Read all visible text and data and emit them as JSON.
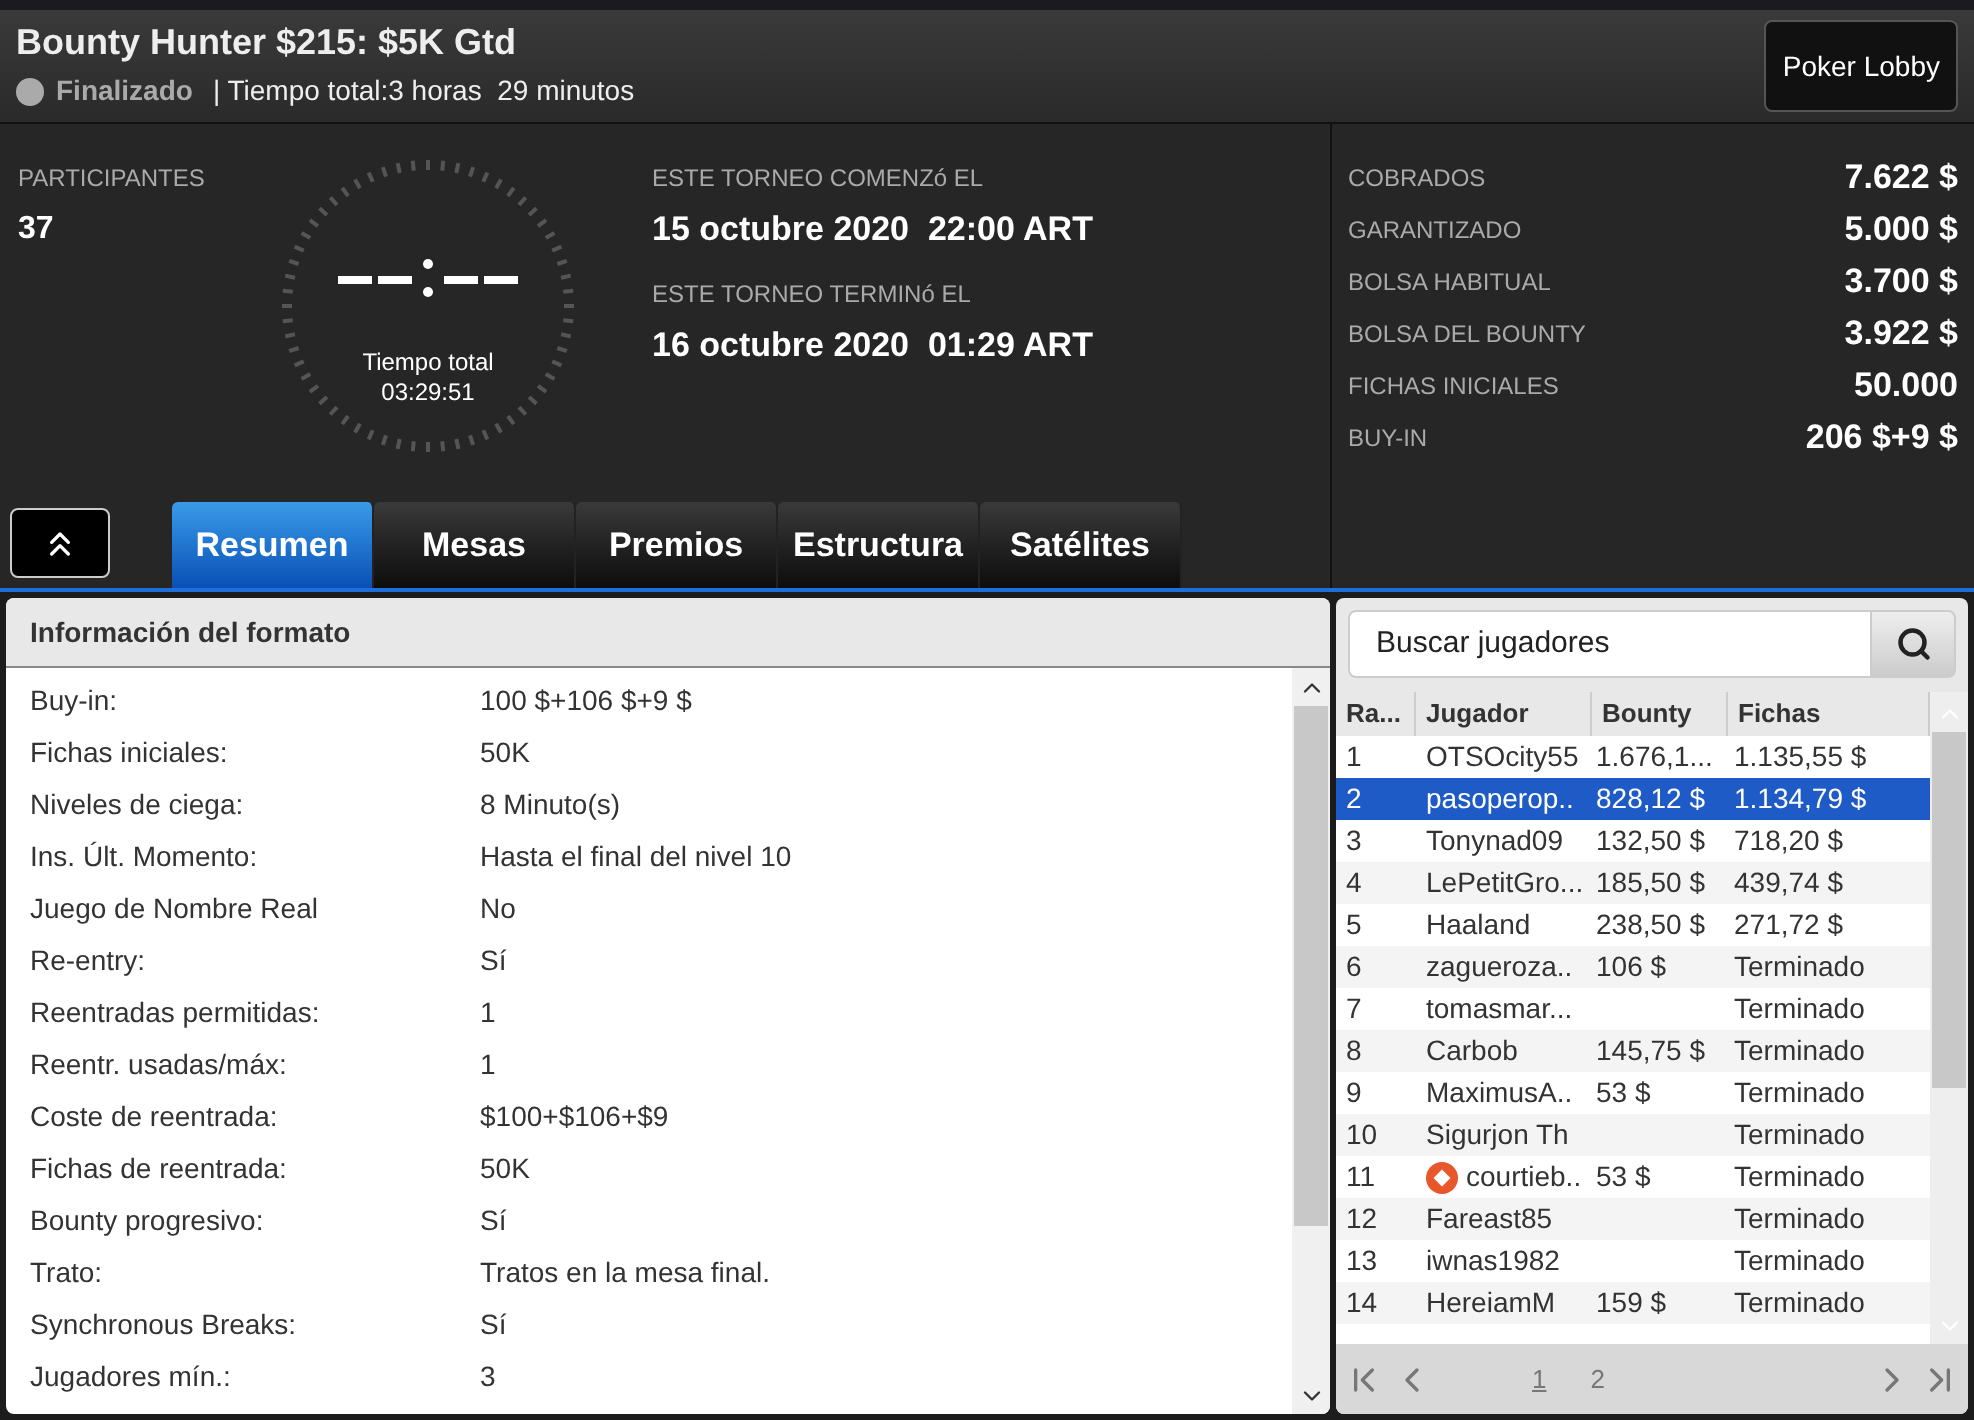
{
  "header": {
    "title": "Bounty Hunter $215: $5K Gtd",
    "status": "Finalizado",
    "duration": "| Tiempo total:3 horas  29 minutos",
    "lobby_button": "Poker Lobby"
  },
  "summary": {
    "participants_label": "PARTICIPANTES",
    "participants": "37",
    "clock_caption": "Tiempo total",
    "clock_time": "03:29:51",
    "dates": [
      {
        "label": "ESTE TORNEO COMENZó EL",
        "value": "15 octubre 2020  22:00 ART"
      },
      {
        "label": "ESTE TORNEO TERMINó EL",
        "value": "16 octubre 2020  01:29 ART"
      }
    ]
  },
  "stats": [
    {
      "label": "COBRADOS",
      "value": "7.622 $"
    },
    {
      "label": "GARANTIZADO",
      "value": "5.000 $"
    },
    {
      "label": "BOLSA HABITUAL",
      "value": "3.700 $"
    },
    {
      "label": "BOLSA DEL BOUNTY",
      "value": "3.922 $"
    },
    {
      "label": "FICHAS INICIALES",
      "value": "50.000"
    },
    {
      "label": "BUY-IN",
      "value": "206 $+9 $"
    }
  ],
  "tabs": [
    {
      "label": "Resumen",
      "selected": true
    },
    {
      "label": "Mesas",
      "selected": false
    },
    {
      "label": "Premios",
      "selected": false
    },
    {
      "label": "Estructura",
      "selected": false
    },
    {
      "label": "Satélites",
      "selected": false
    }
  ],
  "format_info": {
    "title": "Información del formato",
    "rows": [
      {
        "label": "Buy-in:",
        "value": "100 $+106 $+9 $"
      },
      {
        "label": "Fichas iniciales:",
        "value": "50K"
      },
      {
        "label": "Niveles de ciega:",
        "value": "8 Minuto(s)"
      },
      {
        "label": "Ins. Últ. Momento:",
        "value": "Hasta el final del nivel 10"
      },
      {
        "label": "Juego de Nombre Real",
        "value": "No"
      },
      {
        "label": "Re-entry:",
        "value": "Sí"
      },
      {
        "label": "Reentradas permitidas:",
        "value": "1"
      },
      {
        "label": "Reentr. usadas/máx:",
        "value": "1"
      },
      {
        "label": "Coste de reentrada:",
        "value": "$100+$106+$9"
      },
      {
        "label": "Fichas de reentrada:",
        "value": "50K"
      },
      {
        "label": "Bounty progresivo:",
        "value": "Sí"
      },
      {
        "label": "Trato:",
        "value": "Tratos en la mesa final."
      },
      {
        "label": "Synchronous Breaks:",
        "value": "Sí"
      },
      {
        "label": "Jugadores mín.:",
        "value": "3"
      }
    ]
  },
  "players": {
    "search": {
      "placeholder": "Buscar jugadores"
    },
    "columns": [
      "Ra...",
      "Jugador",
      "Bounty",
      "Fichas"
    ],
    "rows": [
      {
        "rank": "1",
        "player": "OTSOcity55",
        "bounty": "1.676,1...",
        "chips": "1.135,55 $",
        "selected": false,
        "badge": false
      },
      {
        "rank": "2",
        "player": "pasoperop..",
        "bounty": "828,12 $",
        "chips": "1.134,79 $",
        "selected": true,
        "badge": false
      },
      {
        "rank": "3",
        "player": "Tonynad09",
        "bounty": "132,50 $",
        "chips": "718,20 $",
        "selected": false,
        "badge": false
      },
      {
        "rank": "4",
        "player": "LePetitGro...",
        "bounty": "185,50 $",
        "chips": "439,74 $",
        "selected": false,
        "badge": false
      },
      {
        "rank": "5",
        "player": "Haaland",
        "bounty": "238,50 $",
        "chips": "271,72 $",
        "selected": false,
        "badge": false
      },
      {
        "rank": "6",
        "player": "zagueroza..",
        "bounty": "106 $",
        "chips": "Terminado",
        "selected": false,
        "badge": false
      },
      {
        "rank": "7",
        "player": "tomasmar...",
        "chips": "Terminado",
        "selected": false,
        "badge": false
      },
      {
        "rank": "8",
        "player": "Carbob",
        "bounty": "145,75 $",
        "chips": "Terminado",
        "selected": false,
        "badge": false
      },
      {
        "rank": "9",
        "player": "MaximusA..",
        "bounty": "53 $",
        "chips": "Terminado",
        "selected": false,
        "badge": false
      },
      {
        "rank": "10",
        "player": "Sigurjon Th",
        "chips": "Terminado",
        "selected": false,
        "badge": false
      },
      {
        "rank": "11",
        "player": "courtieb..",
        "bounty": "53 $",
        "chips": "Terminado",
        "selected": false,
        "badge": true
      },
      {
        "rank": "12",
        "player": "Fareast85",
        "chips": "Terminado",
        "selected": false,
        "badge": false
      },
      {
        "rank": "13",
        "player": "iwnas1982",
        "chips": "Terminado",
        "selected": false,
        "badge": false
      },
      {
        "rank": "14",
        "player": "HereiamM",
        "bounty": "159 $",
        "chips": "Terminado",
        "selected": false,
        "badge": false
      }
    ],
    "pages": [
      {
        "label": "1",
        "selected": true
      },
      {
        "label": "2",
        "selected": false
      }
    ]
  }
}
